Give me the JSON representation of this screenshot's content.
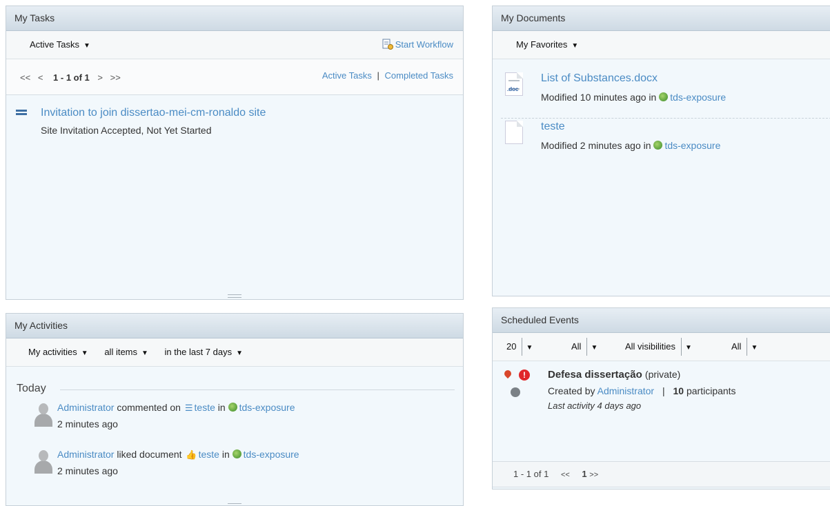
{
  "tasks": {
    "title": "My Tasks",
    "filter": "Active Tasks",
    "start_workflow": "Start Workflow",
    "pager": {
      "first": "<<",
      "prev": "<",
      "range": "1 - 1 of 1",
      "next": ">",
      "last": ">>"
    },
    "links": {
      "active": "Active Tasks",
      "sep": "|",
      "completed": "Completed Tasks"
    },
    "items": [
      {
        "name": "Invitation to join dissertao-mei-cm-ronaldo site",
        "status": "Site Invitation Accepted, Not Yet Started"
      }
    ]
  },
  "documents": {
    "title": "My Documents",
    "filter": "My Favorites",
    "items": [
      {
        "name": "List of Substances.docx",
        "modified": "Modified 10 minutes ago in",
        "site": "tds-exposure",
        "ext": ".doc"
      },
      {
        "name": "teste",
        "modified": "Modified 2 minutes ago in",
        "site": "tds-exposure",
        "ext": ""
      }
    ]
  },
  "activities": {
    "title": "My Activities",
    "filters": [
      "My activities",
      "all items",
      "in the last 7 days"
    ],
    "group": "Today",
    "items": [
      {
        "user": "Administrator",
        "action": "commented on",
        "target": "teste",
        "in": "in",
        "site": "tds-exposure",
        "time": "2 minutes ago"
      },
      {
        "user": "Administrator",
        "action": "liked document",
        "target": "teste",
        "in": "in",
        "site": "tds-exposure",
        "time": "2 minutes ago"
      }
    ]
  },
  "events": {
    "title": "Scheduled Events",
    "filters": {
      "count": "20",
      "type": "All",
      "visibility": "All visibilities",
      "time": "All"
    },
    "items": [
      {
        "title": "Defesa dissertação",
        "privacy": "(private)",
        "created_by": "Created by",
        "user": "Administrator",
        "sep": "|",
        "participants_count": "10",
        "participants_label": "participants",
        "last_activity": "Last activity 4 days ago"
      }
    ],
    "footer": {
      "range": "1 - 1 of 1",
      "prev": "<<",
      "page": "1",
      "next": ">>"
    }
  }
}
